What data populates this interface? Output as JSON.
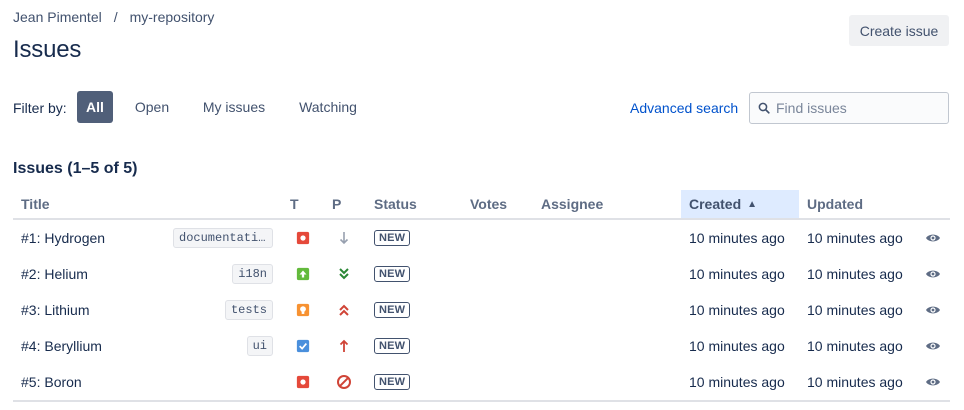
{
  "breadcrumb": {
    "owner": "Jean Pimentel",
    "separator": "/",
    "repo": "my-repository"
  },
  "page": {
    "title": "Issues",
    "create_button": "Create issue"
  },
  "filter": {
    "label": "Filter by:",
    "options": [
      {
        "label": "All",
        "active": true
      },
      {
        "label": "Open",
        "active": false
      },
      {
        "label": "My issues",
        "active": false
      },
      {
        "label": "Watching",
        "active": false
      }
    ],
    "advanced_search": "Advanced search",
    "search_placeholder": "Find issues"
  },
  "table": {
    "count_label": "Issues (1–5 of 5)",
    "columns": {
      "title": "Title",
      "type": "T",
      "priority": "P",
      "status": "Status",
      "votes": "Votes",
      "assignee": "Assignee",
      "created": "Created",
      "updated": "Updated"
    },
    "sorted_by": "created",
    "sort_direction": "ascending",
    "rows": [
      {
        "title": "#1: Hydrogen",
        "label": "documentation",
        "type": "bug",
        "priority": "minor",
        "status": "NEW",
        "votes": "",
        "assignee": "",
        "created": "10 minutes ago",
        "updated": "10 minutes ago"
      },
      {
        "title": "#2: Helium",
        "label": "i18n",
        "type": "enhancement",
        "priority": "trivial",
        "status": "NEW",
        "votes": "",
        "assignee": "",
        "created": "10 minutes ago",
        "updated": "10 minutes ago"
      },
      {
        "title": "#3: Lithium",
        "label": "tests",
        "type": "proposal",
        "priority": "critical",
        "status": "NEW",
        "votes": "",
        "assignee": "",
        "created": "10 minutes ago",
        "updated": "10 minutes ago"
      },
      {
        "title": "#4: Beryllium",
        "label": "ui",
        "type": "task",
        "priority": "major",
        "status": "NEW",
        "votes": "",
        "assignee": "",
        "created": "10 minutes ago",
        "updated": "10 minutes ago"
      },
      {
        "title": "#5: Boron",
        "label": "",
        "type": "bug",
        "priority": "blocker",
        "status": "NEW",
        "votes": "",
        "assignee": "",
        "created": "10 minutes ago",
        "updated": "10 minutes ago"
      }
    ]
  },
  "icons": {
    "bug": {
      "name": "bug-icon",
      "color": "#e5493a"
    },
    "enhancement": {
      "name": "enhancement-icon",
      "color": "#63ba3c"
    },
    "proposal": {
      "name": "proposal-icon",
      "color": "#f79232"
    },
    "task": {
      "name": "task-icon",
      "color": "#4a8fdc"
    },
    "trivial": {
      "name": "priority-trivial-icon",
      "color": "#2a8735"
    },
    "minor": {
      "name": "priority-minor-icon",
      "color": "#97a0af"
    },
    "major": {
      "name": "priority-major-icon",
      "color": "#d04437"
    },
    "critical": {
      "name": "priority-critical-icon",
      "color": "#d04437"
    },
    "blocker": {
      "name": "priority-blocker-icon",
      "color": "#d04437"
    },
    "watch": {
      "name": "eye-icon",
      "color": "#5e6c84"
    }
  }
}
